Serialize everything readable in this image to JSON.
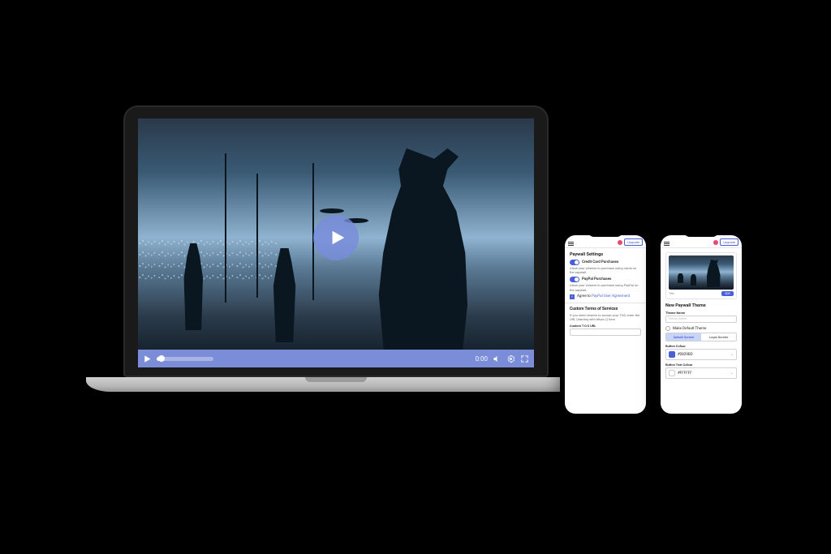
{
  "laptop": {
    "video": {
      "time": "0:00",
      "play_label": "Play"
    }
  },
  "phone1": {
    "header": {
      "upgrade": "Upgrade"
    },
    "paywall": {
      "title": "Paywall Settings",
      "credit": {
        "label": "Credit Card Purchases",
        "desc": "Allow your viewers to purchase using cards on the paywall."
      },
      "paypal": {
        "label": "PayPal Purchases",
        "desc": "Allow your viewers to purchase using PayPal on the paywall."
      },
      "agree_prefix": "Agree to ",
      "agree_link": "PayPal User Agreement"
    },
    "tos": {
      "title": "Custom Terms of Services",
      "desc": "If you need viewers to accept your TOS, enter the URL (starting with https://) here",
      "url_label": "Custom T.O.S URL",
      "url_value": ""
    }
  },
  "phone2": {
    "header": {
      "upgrade": "Upgrade"
    },
    "preview": {
      "title_label": "Title",
      "buy": "BUY"
    },
    "theme": {
      "title": "New Paywall Theme",
      "name_label": "Theme Name",
      "name_placeholder": "Theme Name",
      "default_label": "Make Default Theme",
      "tab_splash": "Splash Screen",
      "tab_login": "Login Screen",
      "button_colour_label": "Button Colour",
      "button_colour_value": "#2829BD",
      "button_text_colour_label": "Button Text Colour",
      "button_text_colour_value": "#FFFFFF"
    }
  }
}
